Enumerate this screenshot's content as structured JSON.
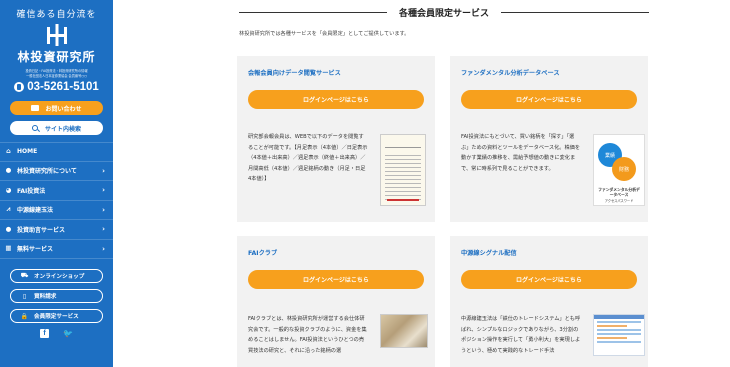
{
  "sidebar": {
    "tagline": "確信ある自分流を",
    "brand": "林投資研究所",
    "small_text": [
      "投資日記・FAI投資法・林投資研究所の情報",
      "一般社団法人日本証券業協会 会員番号○○"
    ],
    "phone": "03-5261-5101",
    "contact_label": "お問い合わせ",
    "search_label": "サイト内検索",
    "nav": [
      {
        "label": "HOME",
        "icon": "home-icon",
        "chevron": false
      },
      {
        "label": "林投資研究所について",
        "icon": "info-icon",
        "chevron": true
      },
      {
        "label": "FAI投資法",
        "icon": "pie-icon",
        "chevron": true
      },
      {
        "label": "中源線建玉法",
        "icon": "chart-icon",
        "chevron": true
      },
      {
        "label": "投資助言サービス",
        "icon": "chat-icon",
        "chevron": true
      },
      {
        "label": "無料サービス",
        "icon": "gift-icon",
        "chevron": true
      }
    ],
    "sub_buttons": [
      {
        "label": "オンラインショップ",
        "icon": "cart-icon"
      },
      {
        "label": "資料請求",
        "icon": "document-icon"
      },
      {
        "label": "会員限定サービス",
        "icon": "lock-icon"
      }
    ],
    "social": {
      "facebook": "f",
      "twitter": "🐦"
    }
  },
  "main": {
    "section_title": "各種会員限定サービス",
    "intro": "林投資研究所では各種サービスを「会員限定」としてご提供しています。",
    "cards": [
      {
        "title": "会報会員向けデータ閲覧サービス",
        "button": "ログインページはこちら",
        "text": "研究部会報会員は、WEBで以下のデータを閲覧することが可能です。【月足表示（4本値）／日足表示（4本値＋出来高）／週足表示（終値＋出来高）／月間高低（4本値）／週足銘柄の動き（月足・日足4本値）】"
      },
      {
        "title": "ファンダメンタル分析データベース",
        "button": "ログインページはこちら",
        "text": "FAI投資法にもとづいて、買い銘柄を「探す」「選ぶ」ための資料とツールをデータベース化。株価を動かす業績の推移を、需給予想値の動きに変化まで、常に時系列で見ることができます。",
        "image": {
          "circle1": "業績",
          "circle2": "財務",
          "caption": "ファンダメンタル分析データベース",
          "caption2": "アクセスパスワード"
        }
      },
      {
        "title": "FAIクラブ",
        "button": "ログインページはこちら",
        "text": "FAIクラブとは、林投資研究所が運営する会仕体研究会です。一般的な投資クラブのように、資金を集めることはしません。FAI投資法というひとつの売買技法の研究と、それに沿った銘柄の選"
      },
      {
        "title": "中源線シグナル配信",
        "button": "ログインページはこちら",
        "text": "中源線建玉法は「鉄仕のトレードシステム」とも呼ばれ、シンプルなロジックでありながら、3分割のポジション操作を実行して「勇小利大」を実現しようという、極めて実践的なトレード手法"
      }
    ]
  }
}
